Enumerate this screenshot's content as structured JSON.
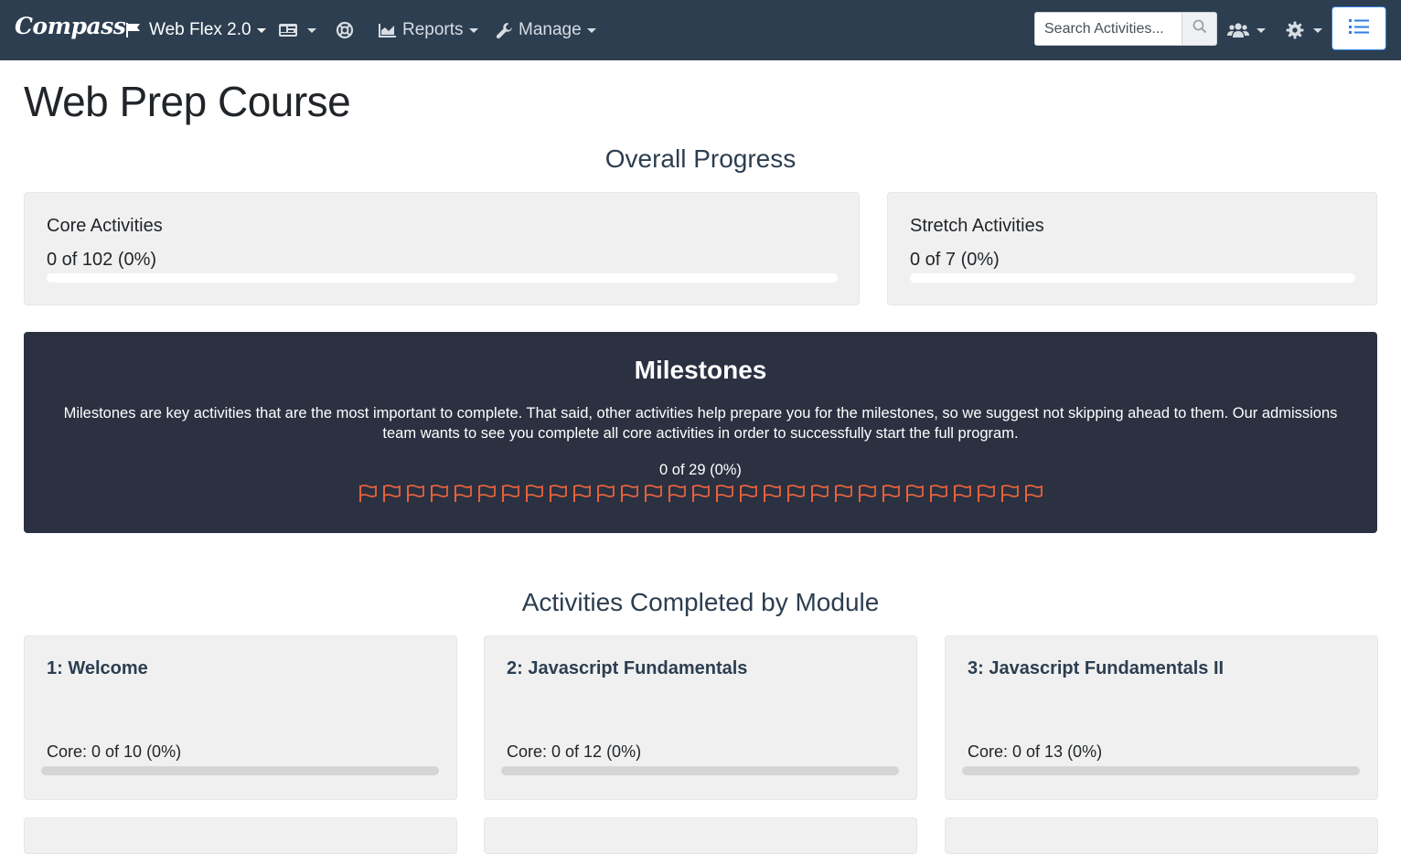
{
  "navbar": {
    "brand": "Compass",
    "course_menu": "Web Flex 2.0",
    "reports_menu": "Reports",
    "manage_menu": "Manage",
    "search": {
      "placeholder": "Search Activities..."
    }
  },
  "page": {
    "title": "Web Prep Course"
  },
  "overall": {
    "heading": "Overall Progress",
    "core": {
      "title": "Core Activities",
      "value": "0 of 102 (0%)",
      "progress": 0
    },
    "stretch": {
      "title": "Stretch Activities",
      "value": "0 of 7 (0%)",
      "progress": 0
    }
  },
  "milestones": {
    "title": "Milestones",
    "description": "Milestones are key activities that are the most important to complete. That said, other activities help prepare you for the milestones, so we suggest not skipping ahead to them. Our admissions team wants to see you complete all core activities in order to successfully start the full program.",
    "count_text": "0 of 29 (0%)",
    "total": 29,
    "completed": 0,
    "flag_color": "#e8613c"
  },
  "modules": {
    "heading": "Activities Completed by Module",
    "items": [
      {
        "title": "1: Welcome",
        "core": "Core: 0 of 10 (0%)",
        "progress": 0
      },
      {
        "title": "2: Javascript Fundamentals",
        "core": "Core: 0 of 12 (0%)",
        "progress": 0
      },
      {
        "title": "3: Javascript Fundamentals II",
        "core": "Core: 0 of 13 (0%)",
        "progress": 0
      }
    ]
  },
  "colors": {
    "navbar": "#2c3e50",
    "milestones_bg": "#2b3141",
    "card_bg": "#f0f0f0",
    "accent": "#2f7de1"
  }
}
